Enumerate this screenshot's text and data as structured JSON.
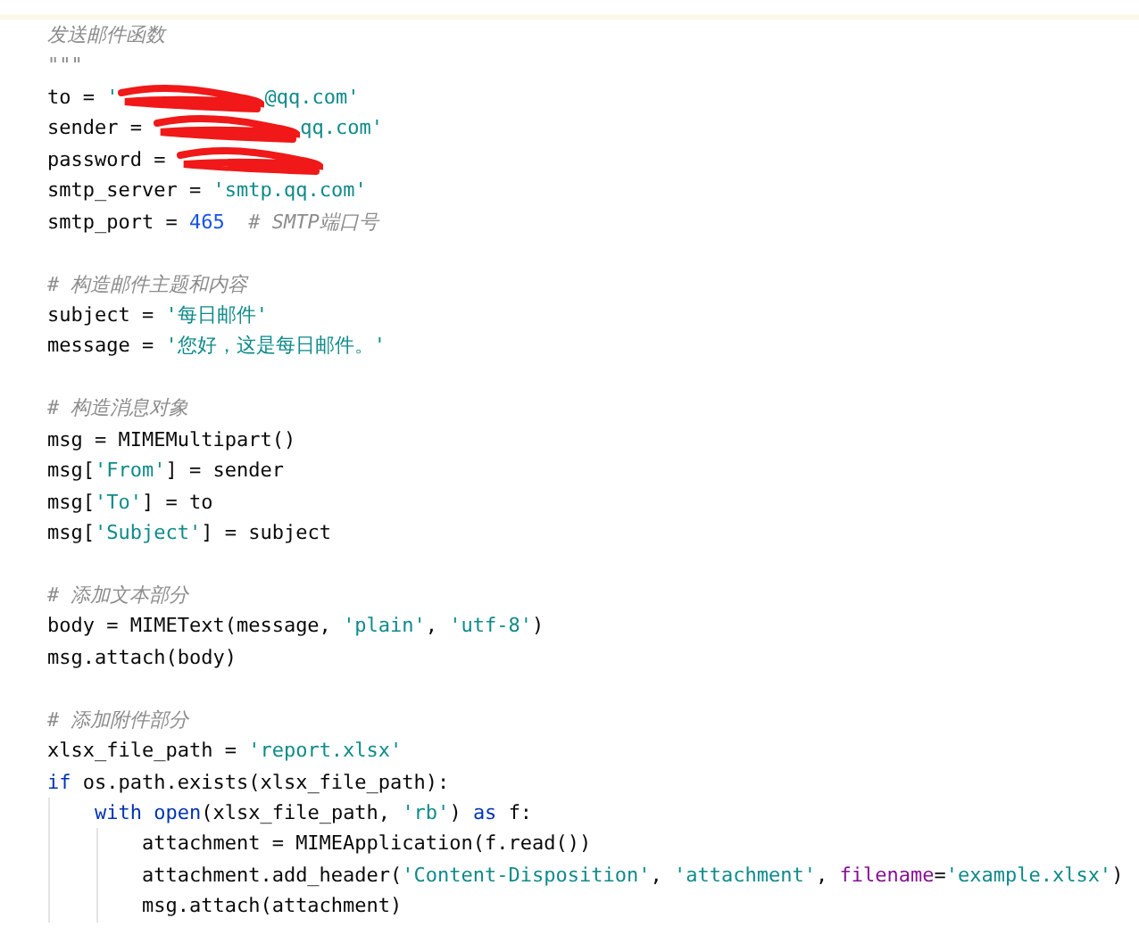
{
  "editor": {
    "lines": [
      {
        "kind": "code",
        "tokens": [
          {
            "kind": "doc",
            "text": "    发送邮件函数"
          }
        ]
      },
      {
        "kind": "code",
        "tokens": [
          {
            "kind": "doc",
            "text": "    \"\"\""
          }
        ]
      },
      {
        "kind": "code",
        "tokens": [
          {
            "kind": "plain",
            "text": "    to = "
          },
          {
            "kind": "str",
            "text": "'"
          },
          {
            "kind": "redaction"
          },
          {
            "kind": "str",
            "text": "@qq.com'"
          }
        ]
      },
      {
        "kind": "code",
        "tokens": [
          {
            "kind": "plain",
            "text": "    sender = "
          },
          {
            "kind": "redaction"
          },
          {
            "kind": "str",
            "text": "qq.com'"
          }
        ]
      },
      {
        "kind": "code",
        "tokens": [
          {
            "kind": "plain",
            "text": "    password = "
          },
          {
            "kind": "redaction"
          }
        ]
      },
      {
        "kind": "code",
        "tokens": [
          {
            "kind": "plain",
            "text": "    smtp_server = "
          },
          {
            "kind": "str",
            "text": "'smtp.qq.com'"
          }
        ]
      },
      {
        "kind": "code",
        "tokens": [
          {
            "kind": "plain",
            "text": "    smtp_port = "
          },
          {
            "kind": "num",
            "text": "465"
          },
          {
            "kind": "comment",
            "text": "  # SMTP端口号"
          }
        ]
      },
      {
        "kind": "blank"
      },
      {
        "kind": "code",
        "tokens": [
          {
            "kind": "comment",
            "text": "    # 构造邮件主题和内容"
          }
        ]
      },
      {
        "kind": "code",
        "tokens": [
          {
            "kind": "plain",
            "text": "    subject = "
          },
          {
            "kind": "str",
            "text": "'每日邮件'"
          }
        ]
      },
      {
        "kind": "code",
        "tokens": [
          {
            "kind": "plain",
            "text": "    message = "
          },
          {
            "kind": "str",
            "text": "'您好，这是每日邮件。'"
          }
        ]
      },
      {
        "kind": "blank"
      },
      {
        "kind": "code",
        "tokens": [
          {
            "kind": "comment",
            "text": "    # 构造消息对象"
          }
        ]
      },
      {
        "kind": "code",
        "tokens": [
          {
            "kind": "plain",
            "text": "    msg = MIMEMultipart()"
          }
        ]
      },
      {
        "kind": "code",
        "tokens": [
          {
            "kind": "plain",
            "text": "    msg["
          },
          {
            "kind": "str",
            "text": "'From'"
          },
          {
            "kind": "plain",
            "text": "] = sender"
          }
        ]
      },
      {
        "kind": "code",
        "tokens": [
          {
            "kind": "plain",
            "text": "    msg["
          },
          {
            "kind": "str",
            "text": "'To'"
          },
          {
            "kind": "plain",
            "text": "] = to"
          }
        ]
      },
      {
        "kind": "code",
        "tokens": [
          {
            "kind": "plain",
            "text": "    msg["
          },
          {
            "kind": "str",
            "text": "'Subject'"
          },
          {
            "kind": "plain",
            "text": "] = subject"
          }
        ]
      },
      {
        "kind": "blank"
      },
      {
        "kind": "code",
        "tokens": [
          {
            "kind": "comment",
            "text": "    # 添加文本部分"
          }
        ]
      },
      {
        "kind": "code",
        "tokens": [
          {
            "kind": "plain",
            "text": "    body = MIMEText(message, "
          },
          {
            "kind": "str",
            "text": "'plain'"
          },
          {
            "kind": "plain",
            "text": ", "
          },
          {
            "kind": "str",
            "text": "'utf-8'"
          },
          {
            "kind": "plain",
            "text": ")"
          }
        ]
      },
      {
        "kind": "code",
        "tokens": [
          {
            "kind": "plain",
            "text": "    msg.attach(body)"
          }
        ]
      },
      {
        "kind": "blank"
      },
      {
        "kind": "code",
        "tokens": [
          {
            "kind": "comment",
            "text": "    # 添加附件部分"
          }
        ]
      },
      {
        "kind": "code",
        "tokens": [
          {
            "kind": "plain",
            "text": "    xlsx_file_path = "
          },
          {
            "kind": "str",
            "text": "'report.xlsx'"
          }
        ]
      },
      {
        "kind": "code",
        "tokens": [
          {
            "kind": "kw",
            "text": "    if "
          },
          {
            "kind": "plain",
            "text": "os.path.exists(xlsx_file_path):"
          }
        ]
      },
      {
        "kind": "code",
        "tokens": [
          {
            "kind": "kw",
            "text": "        with "
          },
          {
            "kind": "builtin",
            "text": "open"
          },
          {
            "kind": "plain",
            "text": "(xlsx_file_path, "
          },
          {
            "kind": "str",
            "text": "'rb'"
          },
          {
            "kind": "plain",
            "text": ") "
          },
          {
            "kind": "kw",
            "text": "as "
          },
          {
            "kind": "plain",
            "text": "f:"
          }
        ]
      },
      {
        "kind": "code",
        "tokens": [
          {
            "kind": "plain",
            "text": "            attachment = MIMEApplication(f.read())"
          }
        ]
      },
      {
        "kind": "code",
        "tokens": [
          {
            "kind": "plain",
            "text": "            attachment.add_header("
          },
          {
            "kind": "str",
            "text": "'Content-Disposition'"
          },
          {
            "kind": "plain",
            "text": ", "
          },
          {
            "kind": "str",
            "text": "'attachment'"
          },
          {
            "kind": "plain",
            "text": ", "
          },
          {
            "kind": "kwarg",
            "text": "filename"
          },
          {
            "kind": "plain",
            "text": "="
          },
          {
            "kind": "str",
            "text": "'example.xlsx'"
          },
          {
            "kind": "plain",
            "text": ")"
          }
        ]
      },
      {
        "kind": "code",
        "tokens": [
          {
            "kind": "plain",
            "text": "            msg.attach(attachment)"
          }
        ]
      }
    ]
  }
}
